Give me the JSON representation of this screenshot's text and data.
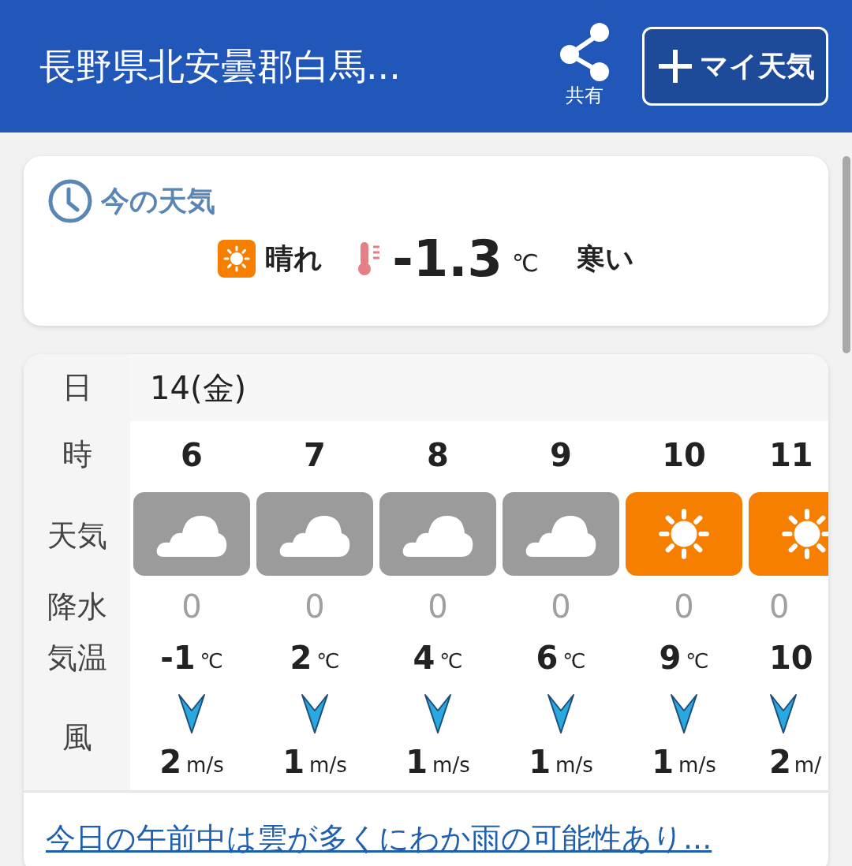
{
  "header": {
    "title": "長野県北安曇郡白馬...",
    "share_label": "共有",
    "my_weather_button": "マイ天気"
  },
  "current": {
    "title": "今の天気",
    "kind": "sunny",
    "condition": "晴れ",
    "temperature": "-1.3",
    "unit": "℃",
    "feel": "寒い"
  },
  "forecast": {
    "row_labels": {
      "date": "日",
      "hour": "時",
      "weather": "天気",
      "precip": "降水",
      "temp": "気温",
      "wind": "風"
    },
    "date": "14(金)",
    "hours": [
      {
        "hour": "6",
        "kind": "cloudy",
        "precip": "0",
        "temp": "-1",
        "temp_unit": "℃",
        "wind_speed": "2",
        "wind_unit": "m/s"
      },
      {
        "hour": "7",
        "kind": "cloudy",
        "precip": "0",
        "temp": "2",
        "temp_unit": "℃",
        "wind_speed": "1",
        "wind_unit": "m/s"
      },
      {
        "hour": "8",
        "kind": "cloudy",
        "precip": "0",
        "temp": "4",
        "temp_unit": "℃",
        "wind_speed": "1",
        "wind_unit": "m/s"
      },
      {
        "hour": "9",
        "kind": "cloudy",
        "precip": "0",
        "temp": "6",
        "temp_unit": "℃",
        "wind_speed": "1",
        "wind_unit": "m/s"
      },
      {
        "hour": "10",
        "kind": "sunny",
        "precip": "0",
        "temp": "9",
        "temp_unit": "℃",
        "wind_speed": "1",
        "wind_unit": "m/s"
      },
      {
        "hour": "11",
        "kind": "sunny",
        "precip": "0",
        "temp": "10",
        "wind_speed": "2",
        "wind_unit": "m/"
      }
    ]
  },
  "summary_link": "今日の午前中は雲が多くにわか雨の可能性あり..."
}
